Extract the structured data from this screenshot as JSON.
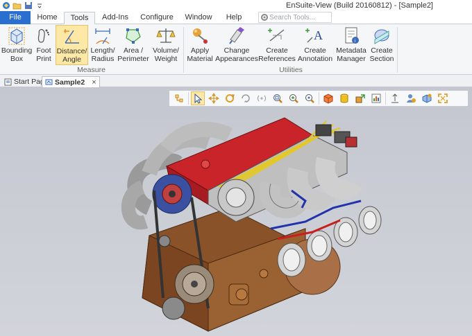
{
  "window": {
    "title": "EnSuite-View (Build 20160812) - [Sample2]"
  },
  "tabs": [
    {
      "label": "File"
    },
    {
      "label": "Home"
    },
    {
      "label": "Tools"
    },
    {
      "label": "Add-Ins"
    },
    {
      "label": "Configure"
    },
    {
      "label": "Window"
    },
    {
      "label": "Help"
    }
  ],
  "active_tab": "Tools",
  "search": {
    "placeholder": "Search Tools..."
  },
  "ribbon": {
    "measure": {
      "label": "Measure",
      "buttons": [
        {
          "line1": "Bounding",
          "line2": "Box",
          "icon": "bounding-box-icon"
        },
        {
          "line1": "Foot",
          "line2": "Print",
          "icon": "footprint-icon"
        },
        {
          "line1": "Distance/",
          "line2": "Angle",
          "icon": "distance-angle-icon"
        },
        {
          "line1": "Length/",
          "line2": "Radius",
          "icon": "length-radius-icon"
        },
        {
          "line1": "Area /",
          "line2": "Perimeter",
          "icon": "area-perimeter-icon"
        },
        {
          "line1": "Volume/",
          "line2": "Weight",
          "icon": "volume-weight-icon"
        }
      ]
    },
    "utilities": {
      "label": "Utilities",
      "buttons": [
        {
          "line1": "Apply",
          "line2": "Material",
          "icon": "apply-material-icon"
        },
        {
          "line1": "Change",
          "line2": "Appearances",
          "icon": "change-appearances-icon"
        },
        {
          "line1": "Create",
          "line2": "References",
          "icon": "create-references-icon"
        },
        {
          "line1": "Create",
          "line2": "Annotation",
          "icon": "create-annotation-icon"
        },
        {
          "line1": "Metadata",
          "line2": "Manager",
          "icon": "metadata-manager-icon"
        },
        {
          "line1": "Create",
          "line2": "Section",
          "icon": "create-section-icon"
        }
      ]
    }
  },
  "doc_tabs": [
    {
      "label": "Start Page"
    },
    {
      "label": "Sample2",
      "close": "×"
    }
  ],
  "colors": {
    "file_tab": "#2a6fcf",
    "selected": "#fde9a5",
    "viewport_bg": "#c9ccd4",
    "engine_red": "#c8242a",
    "engine_bronze": "#8a5228",
    "engine_silver": "#c8c8c8",
    "engine_blue": "#2233aa"
  }
}
